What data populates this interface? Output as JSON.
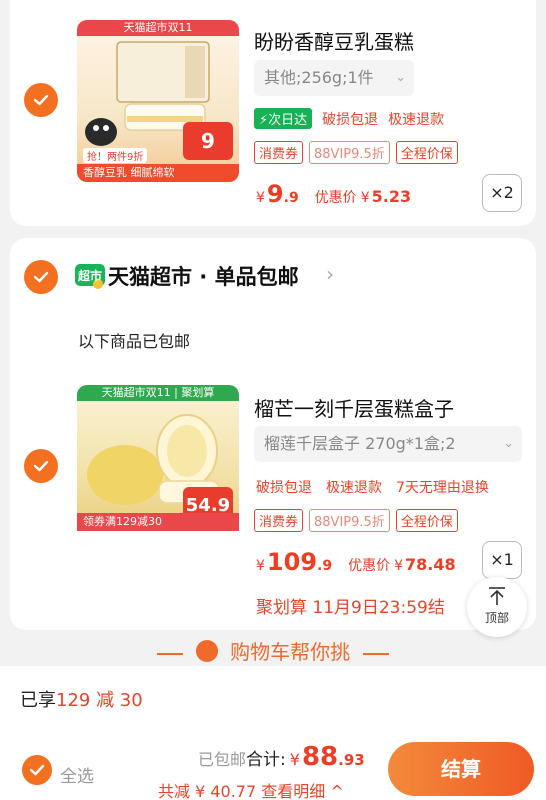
{
  "items": [
    {
      "thumb_band": "天猫超市双11",
      "thumb_bottom": "香醇豆乳 细腻绵软",
      "thumb_tag": "抢！两件9折",
      "thumb_price": "9",
      "title": "盼盼香醇豆乳蛋糕",
      "spec": "其他;256g;1件",
      "tags1": [
        "次日达",
        "破损包退",
        "极速退款"
      ],
      "tags2": [
        "消费券",
        "88VIP9.5折",
        "全程价保"
      ],
      "price_currency": "¥",
      "price_int": "9",
      "price_dec": ".9",
      "discount_label": "优惠价",
      "discount_currency": "¥",
      "discount_value": "5.23",
      "qty": "×2"
    },
    {
      "thumb_band": "天猫超市双11 | 聚划算",
      "thumb_bottom": "领券满129减30",
      "thumb_price": "54.9",
      "title": "榴芒一刻千层蛋糕盒子",
      "spec": "榴莲千层盒子 270g*1盒;2",
      "tags1": [
        "破损包退",
        "极速退款",
        "7天无理由退换"
      ],
      "tags2": [
        "消费券",
        "88VIP9.5折",
        "全程价保"
      ],
      "price_currency": "¥",
      "price_int": "109",
      "price_dec": ".9",
      "discount_label": "优惠价",
      "discount_currency": "¥",
      "discount_value": "78.48",
      "qty": "×1",
      "promo": "聚划算 11月9日23:59结"
    }
  ],
  "store": {
    "logo_text": "超市",
    "name": "天猫超市 · 单品包邮",
    "note": "以下商品已包邮"
  },
  "back_top_label": "顶部",
  "helper_text": "购物车帮你挑",
  "bottom": {
    "enjoy_prefix": "已享",
    "enjoy_highlight": "129 减 30",
    "select_all": "全选",
    "free_ship": "已包邮",
    "total_label": "合计:",
    "total_currency": "¥",
    "total_int": "88",
    "total_dec": ".93",
    "saving": "共减 ¥ 40.77  查看明细 ^",
    "checkout": "结算"
  },
  "colors": {
    "accent": "#f37021",
    "price_red": "#ee3d24",
    "green": "#17b253"
  }
}
